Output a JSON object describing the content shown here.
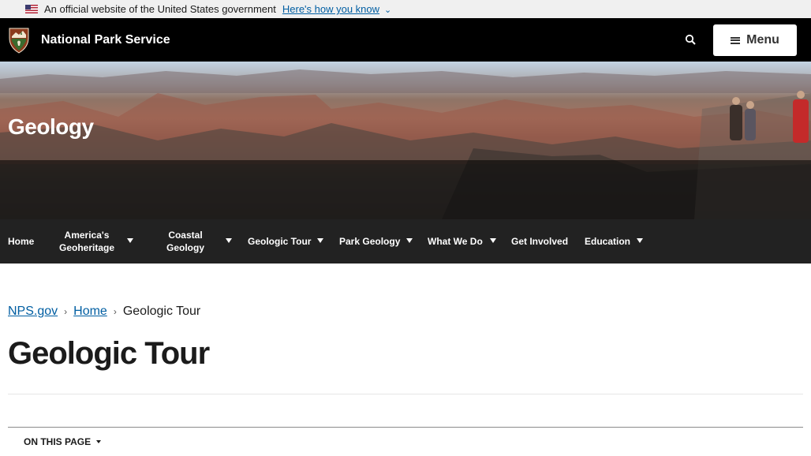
{
  "gov_banner": {
    "text": "An official website of the United States government",
    "link": "Here's how you know"
  },
  "header": {
    "site_name": "National Park Service",
    "menu_label": "Menu",
    "search_icon": "search-icon"
  },
  "hero": {
    "title": "Geology"
  },
  "section_nav": {
    "items": [
      {
        "label": "Home",
        "has_dropdown": false
      },
      {
        "label": "America's Geoheritage",
        "has_dropdown": true
      },
      {
        "label": "Coastal Geology",
        "has_dropdown": true
      },
      {
        "label": "Geologic Tour",
        "has_dropdown": true
      },
      {
        "label": "Park Geology",
        "has_dropdown": true
      },
      {
        "label": "What We Do",
        "has_dropdown": true
      },
      {
        "label": "Get Involved",
        "has_dropdown": false
      },
      {
        "label": "Education",
        "has_dropdown": true
      }
    ]
  },
  "breadcrumb": {
    "items": [
      "NPS.gov",
      "Home"
    ],
    "current": "Geologic Tour"
  },
  "page": {
    "title": "Geologic Tour",
    "on_this_page": "ON THIS PAGE"
  },
  "colors": {
    "link": "#005ea2",
    "header_bg": "#000000",
    "nav_bg": "#222222",
    "banner_bg": "#f0f0f0"
  }
}
